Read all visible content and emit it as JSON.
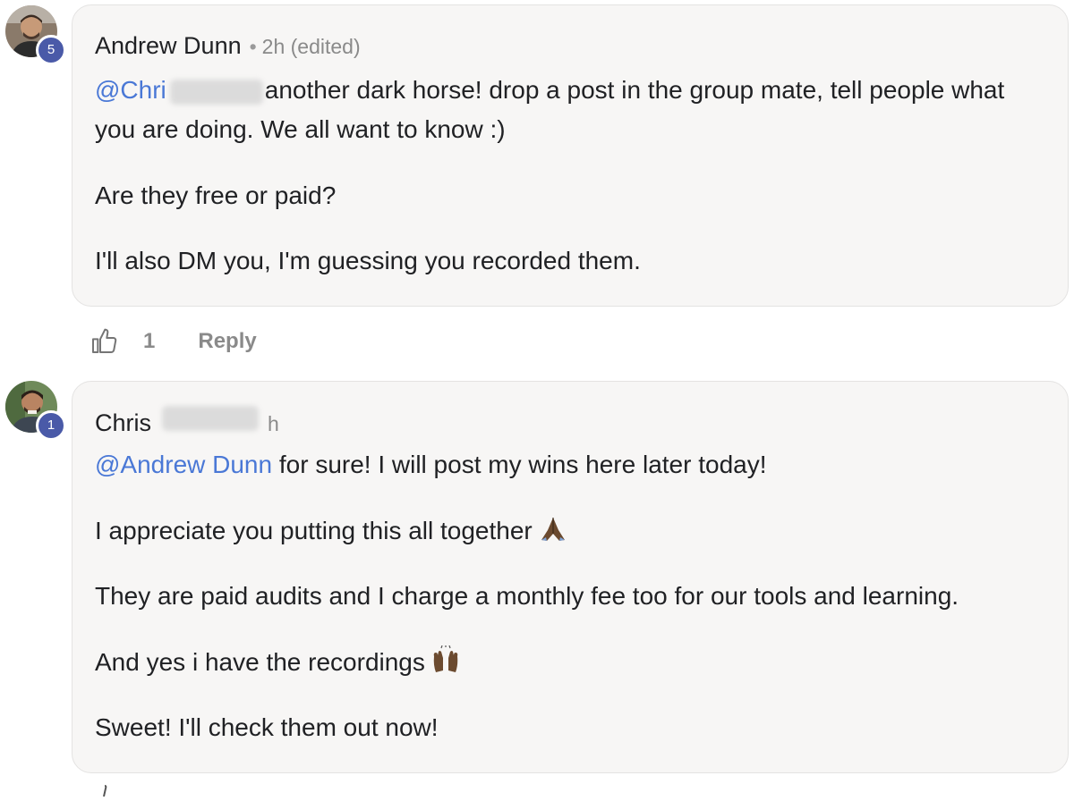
{
  "comments": [
    {
      "author": "Andrew Dunn",
      "level": "5",
      "meta": "2h (edited)",
      "mention": "@Chri",
      "first_text": "another dark horse! drop a post in the group mate, tell people what",
      "first_text_cont": "you are doing. We all want to know :)",
      "paragraphs": [
        "Are they free or paid?",
        "I'll also DM you, I'm guessing you recorded them."
      ],
      "like_count": "1",
      "reply_label": "Reply"
    },
    {
      "author": "Chris",
      "level": "1",
      "meta": "h",
      "mention": "@Andrew Dunn",
      "first_text": " for sure! I will post my wins here later today!",
      "paragraphs": [
        "I appreciate you putting this all together",
        "They are paid audits and I charge a monthly fee too for our tools and learning.",
        "And yes i have the recordings",
        "Sweet! I'll check them out now!"
      ]
    }
  ],
  "icons": {
    "like": "thumbs-up-icon",
    "pray": "folded-hands-emoji",
    "raise": "raising-hands-emoji"
  },
  "colors": {
    "mention": "#4a78d6",
    "badge": "#4a5aa8",
    "bubble": "#f7f6f5",
    "muted": "#8a8a8a"
  }
}
